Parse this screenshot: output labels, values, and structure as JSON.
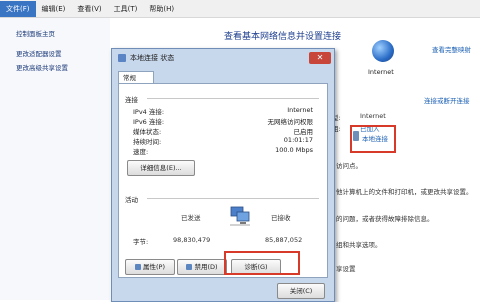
{
  "menu": [
    "文件(F)",
    "编辑(E)",
    "查看(V)",
    "工具(T)",
    "帮助(H)"
  ],
  "left_links": [
    "控制面板主页",
    "更改适配器设置",
    "更改高级共享设置"
  ],
  "main": {
    "title": "查看基本网络信息并设置连接",
    "view_full_map": "查看完整映射",
    "internet_label": "Internet",
    "connect_or_disconnect": "连接或断开连接",
    "access_type_label": "型:",
    "access_type_value": "Internet",
    "homegroup_label": "组:",
    "homegroup_value": "已加入",
    "connection_label": "本地连接",
    "partial_texts": [
      "访问点。",
      "他计算机上的文件和打印机，或更改共享设置。",
      "的问题，或者获得故障排除信息。",
      "组和共享选项。",
      "享设置"
    ]
  },
  "dialog": {
    "title": "本地连接 状态",
    "tab": "常规",
    "connection_section": "连接",
    "rows": [
      {
        "label": "IPv4 连接:",
        "value": "Internet"
      },
      {
        "label": "IPv6 连接:",
        "value": "无网络访问权限"
      },
      {
        "label": "媒体状态:",
        "value": "已启用"
      },
      {
        "label": "持续时间:",
        "value": "01:01:17"
      },
      {
        "label": "速度:",
        "value": "100.0 Mbps"
      }
    ],
    "details_button": "详细信息(E)...",
    "activity_section": "活动",
    "sent_label": "已发送",
    "received_label": "已接收",
    "bytes_label": "字节:",
    "bytes_sent": "98,830,479",
    "bytes_received": "85,887,052",
    "properties_button": "属性(P)",
    "disable_button": "禁用(D)",
    "diagnose_button": "诊断(G)",
    "close_button": "关闭(C)"
  }
}
